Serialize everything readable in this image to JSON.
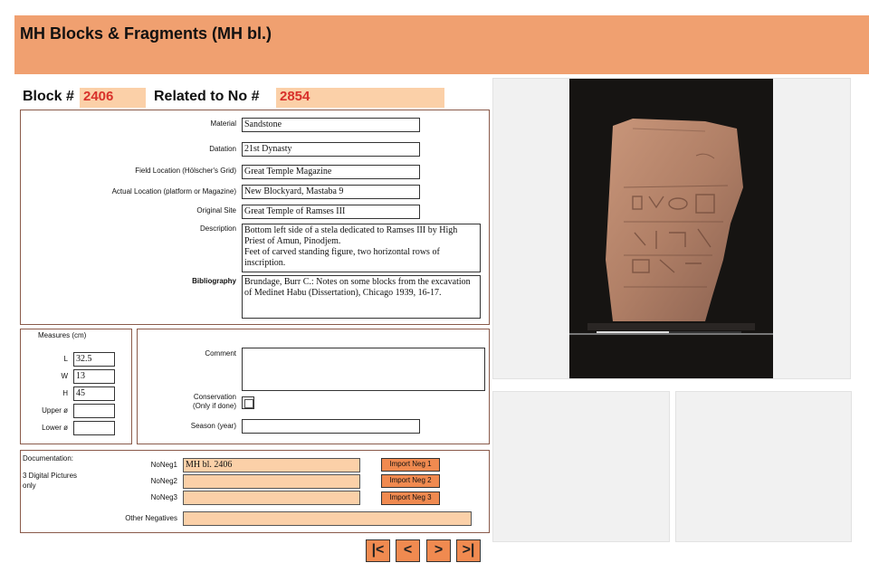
{
  "header": {
    "title": "MH Blocks & Fragments (MH bl.)"
  },
  "block": {
    "label": "Block #",
    "value": "2406",
    "related_label": "Related to No #",
    "related_value": "2854"
  },
  "details": {
    "material_label": "Material",
    "material": "Sandstone",
    "datation_label": "Datation",
    "datation": "21st Dynasty",
    "field_location_label": "Field Location (Hölscher's Grid)",
    "field_location": "Great Temple Magazine",
    "actual_location_label": "Actual Location (platform or Magazine)",
    "actual_location": "New Blockyard, Mastaba 9",
    "original_site_label": "Original Site",
    "original_site": "Great Temple of Ramses III",
    "description_label": "Description",
    "description_1": "Bottom left side of a stela dedicated to Ramses III by High Priest of Amun, Pinodjem.",
    "description_2": "Feet of carved standing figure, two horizontal rows of inscription.",
    "bibliography_label": "Bibliography",
    "bibliography": "Brundage, Burr C.: Notes on some blocks from the excavation of Medinet Habu (Dissertation), Chicago 1939, 16-17."
  },
  "measures": {
    "title": "Measures (cm)",
    "l_label": "L",
    "l": "32.5",
    "w_label": "W",
    "w": "13",
    "h_label": "H",
    "h": "45",
    "upper_label": "Upper ø",
    "upper": "",
    "lower_label": "Lower ø",
    "lower": ""
  },
  "notes": {
    "comment_label": "Comment",
    "comment": "",
    "conservation_label_1": "Conservation",
    "conservation_label_2": "(Only if done)",
    "season_label": "Season (year)",
    "season": ""
  },
  "documentation": {
    "title": "Documentation:",
    "note_1": "3 Digital Pictures",
    "note_2": "only",
    "neg1_label": "NoNeg1",
    "neg1": "MH bl. 2406",
    "neg2_label": "NoNeg2",
    "neg2": "",
    "neg3_label": "NoNeg3",
    "neg3": "",
    "import1": "Import Neg 1",
    "import2": "Import Neg 2",
    "import3": "Import Neg 3",
    "other_label": "Other Negatives",
    "other": ""
  },
  "nav": {
    "first": "|<",
    "prev": "<",
    "next": ">",
    "last": ">|"
  },
  "colors": {
    "header": "#f0a070",
    "accent_text": "#d8302a",
    "field_highlight": "#fbd0a8",
    "button": "#f08a50"
  }
}
